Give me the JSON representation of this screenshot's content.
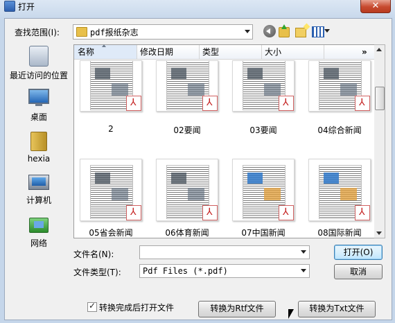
{
  "window": {
    "title": "打开",
    "close_label": "✕"
  },
  "toolbar": {
    "lookin_label": "查找范围(I):",
    "lookin_value": "pdf报纸杂志",
    "icons": [
      "back-icon",
      "up-folder-icon",
      "new-folder-icon",
      "view-menu-icon"
    ]
  },
  "places": [
    {
      "label": "最近访问的位置",
      "icon": "recent-places-icon"
    },
    {
      "label": "桌面",
      "icon": "desktop-icon"
    },
    {
      "label": "hexia",
      "icon": "user-folder-icon"
    },
    {
      "label": "计算机",
      "icon": "computer-icon"
    },
    {
      "label": "网络",
      "icon": "network-icon"
    }
  ],
  "columns": {
    "name": "名称",
    "date": "修改日期",
    "type": "类型",
    "size": "大小",
    "more": "»"
  },
  "files": [
    {
      "name": "2",
      "color": false
    },
    {
      "name": "02要闻",
      "color": false
    },
    {
      "name": "03要闻",
      "color": false
    },
    {
      "name": "04综合新闻",
      "color": false
    },
    {
      "name": "05省会新闻",
      "color": false
    },
    {
      "name": "06体育新闻",
      "color": false
    },
    {
      "name": "07中国新闻",
      "color": true
    },
    {
      "name": "08国际新闻",
      "color": true
    }
  ],
  "form": {
    "filename_label": "文件名(N):",
    "filename_value": "",
    "filetype_label": "文件类型(T):",
    "filetype_value": "Pdf Files (*.pdf)",
    "open_button": "打开(O)",
    "cancel_button": "取消",
    "checkbox_label": "转换完成后打开文件",
    "checkbox_checked": true,
    "convert_rtf_button": "转换为Rtf文件",
    "convert_txt_button": "转换为Txt文件"
  }
}
